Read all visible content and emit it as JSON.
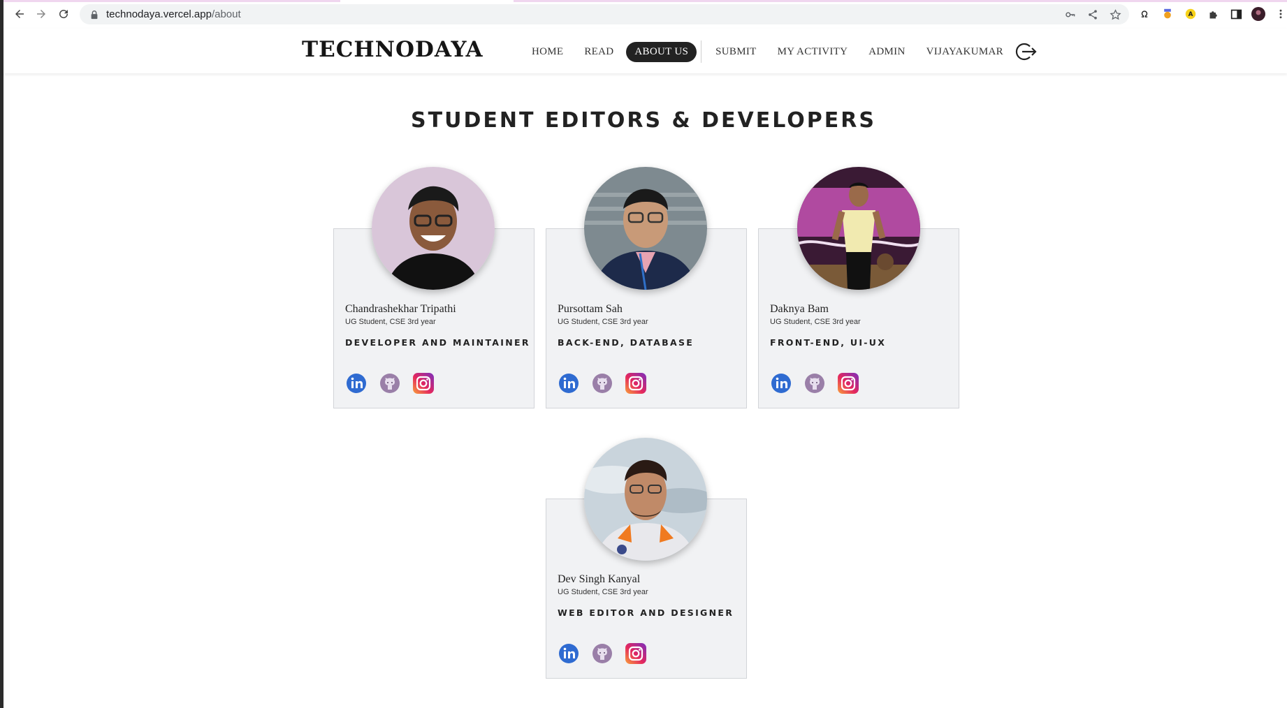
{
  "browser": {
    "url_host": "technodaya.vercel.app",
    "url_path": "/about"
  },
  "site": {
    "logo": "TECHNODAYA",
    "nav": [
      {
        "label": "HOME",
        "active": false
      },
      {
        "label": "READ",
        "active": false
      },
      {
        "label": "ABOUT US",
        "active": true
      },
      {
        "label": "SUBMIT",
        "active": false
      },
      {
        "label": "MY ACTIVITY",
        "active": false
      },
      {
        "label": "ADMIN",
        "active": false
      },
      {
        "label": "VIJAYAKUMAR",
        "active": false
      }
    ]
  },
  "page": {
    "heading": "STUDENT EDITORS & DEVELOPERS"
  },
  "team": [
    {
      "name": "Chandrashekhar Tripathi",
      "role": "UG Student, CSE 3rd year",
      "specialty": "DEVELOPER AND MAINTAINER",
      "photo_bg": "#d9c6d9",
      "shirt": "#111111",
      "skin": "#8a5a3c"
    },
    {
      "name": "Pursottam Sah",
      "role": "UG Student, CSE 3rd year",
      "specialty": "BACK-END, DATABASE",
      "photo_bg": "#7e8a90",
      "shirt": "#1d2a4a",
      "skin": "#c89a78"
    },
    {
      "name": "Daknya Bam",
      "role": "UG Student, CSE 3rd year",
      "specialty": "FRONT-END, UI-UX",
      "photo_bg": "#5b2a4e",
      "shirt": "#f1eab0",
      "skin": "#9a6a4a"
    },
    {
      "name": "Dev Singh Kanyal",
      "role": "UG Student, CSE 3rd year",
      "specialty": "WEB EDITOR AND DESIGNER",
      "photo_bg": "#c9d4dc",
      "shirt": "#e8e8ec",
      "skin": "#c08a68"
    }
  ],
  "icons": [
    "linkedin-icon",
    "github-icon",
    "instagram-icon"
  ],
  "colors": {
    "linkedin": "#2f6bd1",
    "github": "#9a7fa8",
    "nav_active": "#222222"
  }
}
